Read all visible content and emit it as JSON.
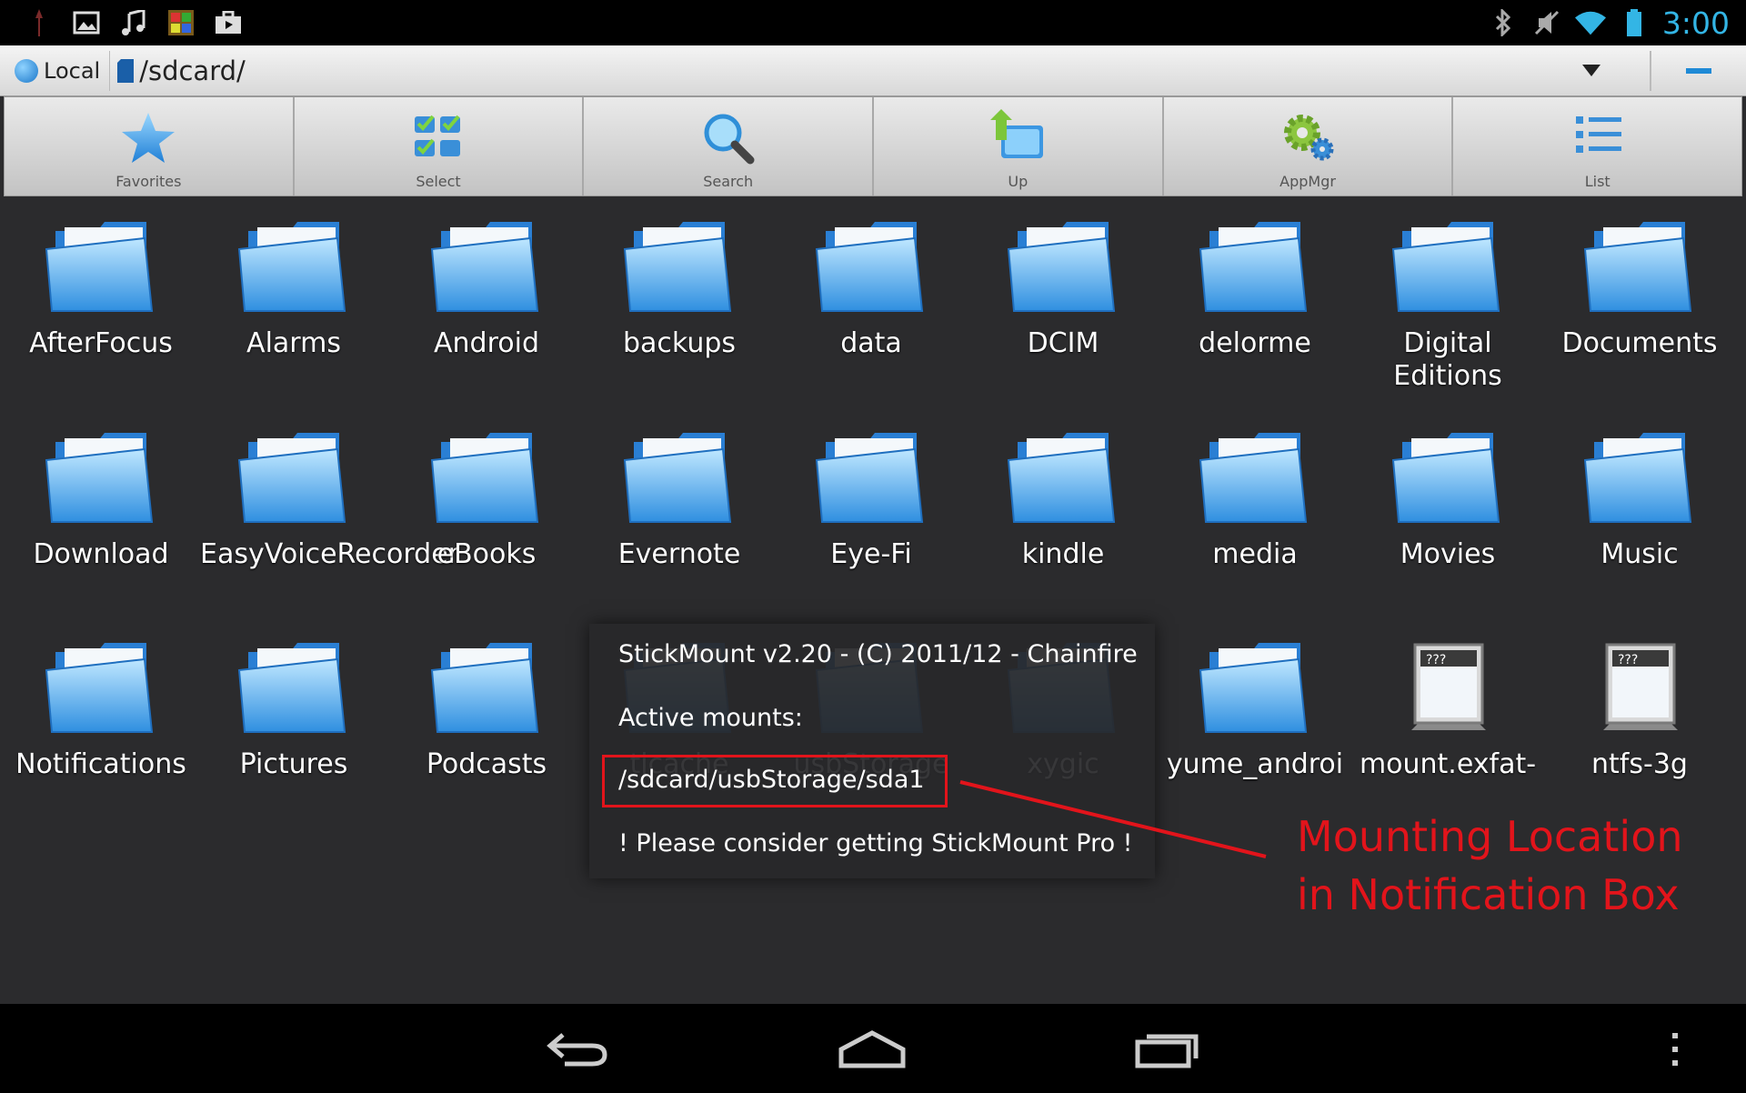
{
  "status_bar": {
    "time": "3:00",
    "left_icons": [
      "usb-debug-icon",
      "gallery-icon",
      "music-icon",
      "app-icon",
      "briefcase-icon"
    ],
    "right_icons": [
      "bluetooth-icon",
      "mute-icon",
      "wifi-icon",
      "battery-icon"
    ]
  },
  "path_bar": {
    "local_label": "Local",
    "path": "/sdcard/"
  },
  "toolbar": {
    "buttons": [
      {
        "label": "Favorites",
        "icon": "star-icon"
      },
      {
        "label": "Select",
        "icon": "select-icon"
      },
      {
        "label": "Search",
        "icon": "search-icon"
      },
      {
        "label": "Up",
        "icon": "up-folder-icon"
      },
      {
        "label": "AppMgr",
        "icon": "gear-icon"
      },
      {
        "label": "List",
        "icon": "list-icon"
      }
    ]
  },
  "files": [
    {
      "name": "AfterFocus",
      "type": "folder"
    },
    {
      "name": "Alarms",
      "type": "folder"
    },
    {
      "name": "Android",
      "type": "folder"
    },
    {
      "name": "backups",
      "type": "folder"
    },
    {
      "name": "data",
      "type": "folder"
    },
    {
      "name": "DCIM",
      "type": "folder"
    },
    {
      "name": "delorme",
      "type": "folder"
    },
    {
      "name": "Digital Editions",
      "type": "folder"
    },
    {
      "name": "Documents",
      "type": "folder"
    },
    {
      "name": "Download",
      "type": "folder"
    },
    {
      "name": "EasyVoiceRecorder",
      "type": "folder"
    },
    {
      "name": "eBooks",
      "type": "folder"
    },
    {
      "name": "Evernote",
      "type": "folder"
    },
    {
      "name": "Eye-Fi",
      "type": "folder"
    },
    {
      "name": "kindle",
      "type": "folder"
    },
    {
      "name": "media",
      "type": "folder"
    },
    {
      "name": "Movies",
      "type": "folder"
    },
    {
      "name": "Music",
      "type": "folder"
    },
    {
      "name": "Notifications",
      "type": "folder"
    },
    {
      "name": "Pictures",
      "type": "folder"
    },
    {
      "name": "Podcasts",
      "type": "folder"
    },
    {
      "name": "tjcache",
      "type": "folder"
    },
    {
      "name": "usbStorage",
      "type": "folder"
    },
    {
      "name": "xygic",
      "type": "folder"
    },
    {
      "name": "yume_androi",
      "type": "folder"
    },
    {
      "name": "mount.exfat-",
      "type": "file"
    },
    {
      "name": "ntfs-3g",
      "type": "file"
    }
  ],
  "popup": {
    "title": "StickMount v2.20 - (C) 2011/12 - Chainfire",
    "active_label": "Active mounts:",
    "mount_path": "/sdcard/usbStorage/sda1",
    "promo": "! Please consider getting StickMount Pro !"
  },
  "annotation": {
    "line1": "Mounting Location",
    "line2": "in Notification Box",
    "color": "#e2141b"
  },
  "nav_bar": {
    "buttons": [
      "back-icon",
      "home-icon",
      "recent-apps-icon",
      "overflow-menu-icon"
    ]
  }
}
